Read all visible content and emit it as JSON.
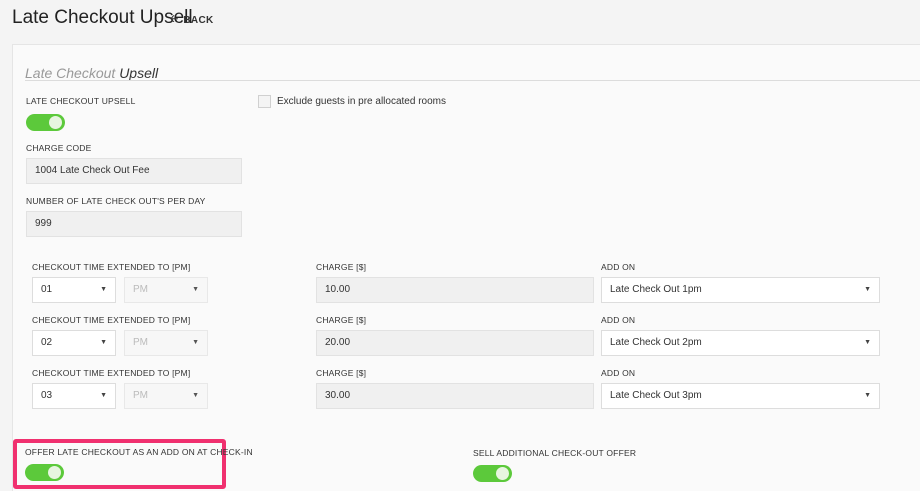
{
  "header": {
    "title": "Late Checkout Upsell",
    "back_label": "BACK"
  },
  "section": {
    "title_light": "Late Checkout",
    "title_dark": "Upsell"
  },
  "late_checkout_upsell": {
    "label": "LATE CHECKOUT UPSELL",
    "enabled": true
  },
  "exclude_guests": {
    "label": "Exclude guests in pre allocated rooms",
    "checked": false
  },
  "charge_code": {
    "label": "CHARGE CODE",
    "value": "1004 Late Check Out Fee"
  },
  "per_day": {
    "label": "NUMBER OF LATE CHECK OUT'S PER DAY",
    "value": "999"
  },
  "extensions": [
    {
      "time_label": "CHECKOUT TIME EXTENDED TO [PM]",
      "hour": "01",
      "meridiem": "PM",
      "charge_label": "CHARGE [$]",
      "charge": "10.00",
      "addon_label": "ADD ON",
      "addon": "Late Check Out 1pm"
    },
    {
      "time_label": "CHECKOUT TIME EXTENDED TO [PM]",
      "hour": "02",
      "meridiem": "PM",
      "charge_label": "CHARGE [$]",
      "charge": "20.00",
      "addon_label": "ADD ON",
      "addon": "Late Check Out 2pm"
    },
    {
      "time_label": "CHECKOUT TIME EXTENDED TO [PM]",
      "hour": "03",
      "meridiem": "PM",
      "charge_label": "CHARGE [$]",
      "charge": "30.00",
      "addon_label": "ADD ON",
      "addon": "Late Check Out 3pm"
    }
  ],
  "offer_at_checkin": {
    "label": "OFFER LATE CHECKOUT AS AN ADD ON AT CHECK-IN",
    "enabled": true
  },
  "sell_additional": {
    "label": "SELL ADDITIONAL CHECK-OUT OFFER",
    "enabled": true
  },
  "icons": {
    "back": "arrow-left-icon",
    "caret": "caret-down-icon"
  },
  "colors": {
    "toggle_on": "#5cc93b",
    "highlight": "#f0306f"
  }
}
